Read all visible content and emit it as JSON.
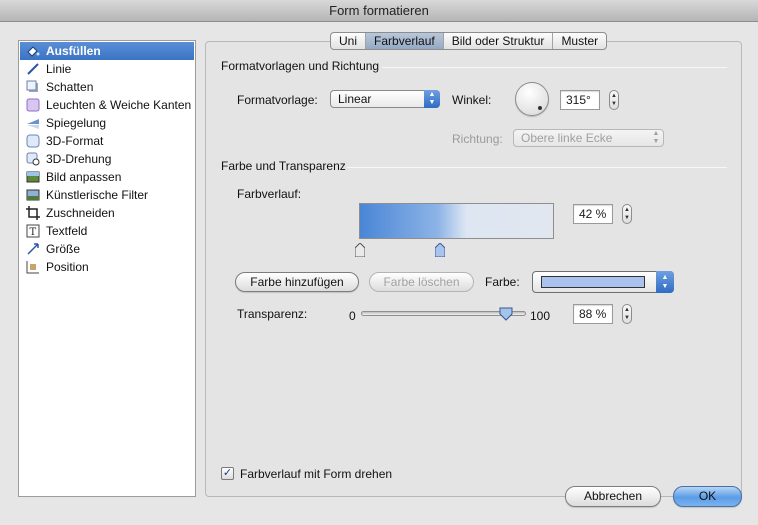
{
  "window": {
    "title": "Form formatieren"
  },
  "sidebar": {
    "items": [
      {
        "label": "Ausfüllen",
        "icon": "paint-bucket-icon",
        "selected": true
      },
      {
        "label": "Linie",
        "icon": "line-icon"
      },
      {
        "label": "Schatten",
        "icon": "shadow-icon"
      },
      {
        "label": "Leuchten & Weiche Kanten",
        "icon": "glow-icon"
      },
      {
        "label": "Spiegelung",
        "icon": "reflection-icon"
      },
      {
        "label": "3D-Format",
        "icon": "3d-format-icon"
      },
      {
        "label": "3D-Drehung",
        "icon": "3d-rotation-icon"
      },
      {
        "label": "Bild anpassen",
        "icon": "picture-adjust-icon"
      },
      {
        "label": "Künstlerische Filter",
        "icon": "artistic-filter-icon"
      },
      {
        "label": "Zuschneiden",
        "icon": "crop-icon"
      },
      {
        "label": "Textfeld",
        "icon": "textbox-icon"
      },
      {
        "label": "Größe",
        "icon": "size-icon"
      },
      {
        "label": "Position",
        "icon": "position-icon"
      }
    ]
  },
  "tabs": [
    {
      "label": "Uni"
    },
    {
      "label": "Farbverlauf",
      "active": true
    },
    {
      "label": "Bild oder Struktur"
    },
    {
      "label": "Muster"
    }
  ],
  "section1": {
    "title": "Formatvorlagen und Richtung",
    "style_label": "Formatvorlage:",
    "style_value": "Linear",
    "angle_label": "Winkel:",
    "angle_value": "315°",
    "direction_label": "Richtung:",
    "direction_value": "Obere linke Ecke"
  },
  "section2": {
    "title": "Farbe und Transparenz",
    "gradient_label": "Farbverlauf:",
    "gradient_position": "42 %",
    "add_color_label": "Farbe hinzufügen",
    "delete_color_label": "Farbe löschen",
    "color_label": "Farbe:",
    "color_value": "#a9c3ee",
    "transparency_label": "Transparenz:",
    "transparency_min": "0",
    "transparency_max": "100",
    "transparency_value": "88 %",
    "transparency_fraction": 0.88
  },
  "rotate_checkbox": {
    "label": "Farbverlauf mit Form drehen",
    "checked": true
  },
  "buttons": {
    "cancel_label": "Abbrechen",
    "ok_label": "OK"
  },
  "colors": {
    "selection": "#3b73c4",
    "gradient_start": "#4a86d6",
    "gradient_end": "#e2e7ef"
  }
}
